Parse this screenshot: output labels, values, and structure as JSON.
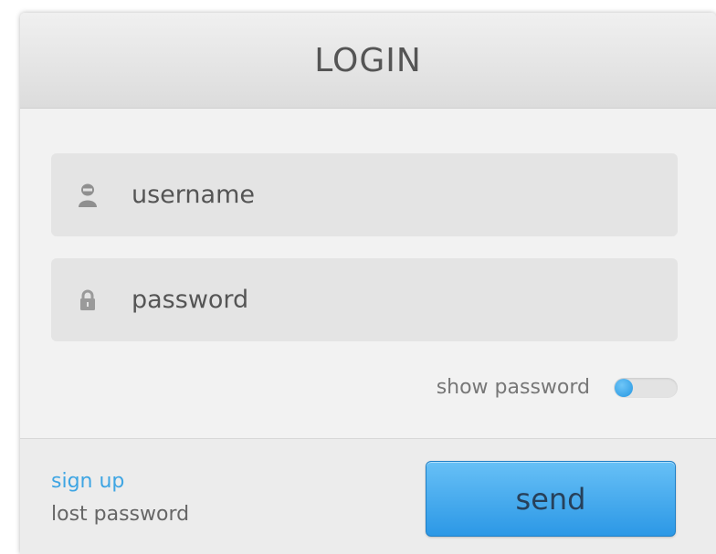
{
  "header": {
    "title": "LOGIN"
  },
  "fields": {
    "username": {
      "placeholder": "username",
      "value": "",
      "icon": "user-icon"
    },
    "password": {
      "placeholder": "password",
      "value": "",
      "icon": "lock-icon"
    }
  },
  "show_password": {
    "label": "show password",
    "enabled": false
  },
  "footer": {
    "sign_up": "sign up",
    "lost_password": "lost password",
    "send_label": "send"
  },
  "colors": {
    "accent": "#2c98e6",
    "link": "#3ea5e3",
    "field_bg": "#e4e4e4",
    "panel_bg": "#f2f2f2"
  }
}
